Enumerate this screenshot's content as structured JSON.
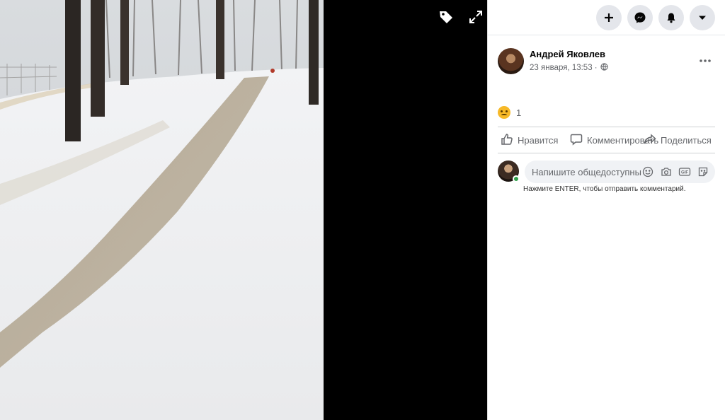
{
  "post": {
    "author": "Андрей Яковлев",
    "date": "23 января, 13:53 ·",
    "privacy_icon": "globe-icon"
  },
  "reactions": {
    "icon": "sad-emoji",
    "count": "1"
  },
  "actions": {
    "like": "Нравится",
    "comment": "Комментировать",
    "share": "Поделиться"
  },
  "composer": {
    "placeholder": "Напишите общедоступный комментарий…",
    "hint": "Нажмите ENTER, чтобы отправить комментарий.",
    "icons": [
      "emoji-icon",
      "camera-icon",
      "gif-icon",
      "sticker-icon"
    ]
  },
  "topbar": {
    "buttons": [
      "plus-icon",
      "messenger-icon",
      "bell-icon",
      "caret-down-icon"
    ]
  },
  "colors": {
    "accent": "#1877f2",
    "muted": "#65676b",
    "button_bg": "#e4e6eb"
  }
}
